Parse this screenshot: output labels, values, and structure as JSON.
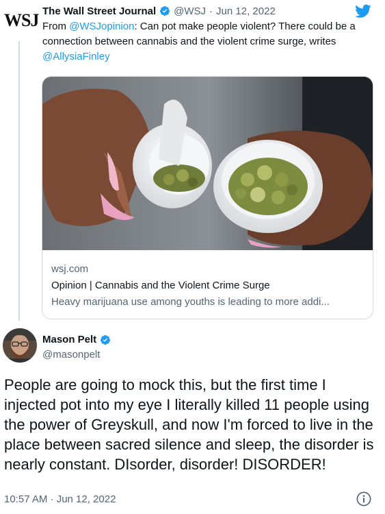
{
  "quoted_tweet": {
    "logo_text": "WSJ",
    "display_name": "The Wall Street Journal",
    "handle": "@WSJ",
    "separator": "·",
    "date": "Jun 12, 2022",
    "text_prefix": "From ",
    "mention_1": "@WSJopinion",
    "text_middle": ": Can pot make people violent? There could be a connection between cannabis and the violent crime surge, writes ",
    "mention_2": "@AllysiaFinley",
    "card": {
      "domain": "wsj.com",
      "title": "Opinion | Cannabis and the Violent Crime Surge",
      "description": "Heavy marijuana use among youths is leading to more addi..."
    }
  },
  "main_tweet": {
    "display_name": "Mason Pelt",
    "handle": "@masonpelt",
    "text": "People are going to mock this, but the first time I injected pot into my eye I literally killed 11 people using the power of Greyskull, and now I'm forced to live in the place between sacred silence and sleep, the disorder is nearly constant. DIsorder, disorder! DISORDER!",
    "timestamp": "10:57 AM · Jun 12, 2022"
  },
  "colors": {
    "accent": "#1d9bf0",
    "text_primary": "#0f1419",
    "text_secondary": "#536471",
    "border": "#cfd9de"
  },
  "icons": [
    "twitter-bird-icon",
    "verified-badge-icon",
    "info-icon"
  ]
}
